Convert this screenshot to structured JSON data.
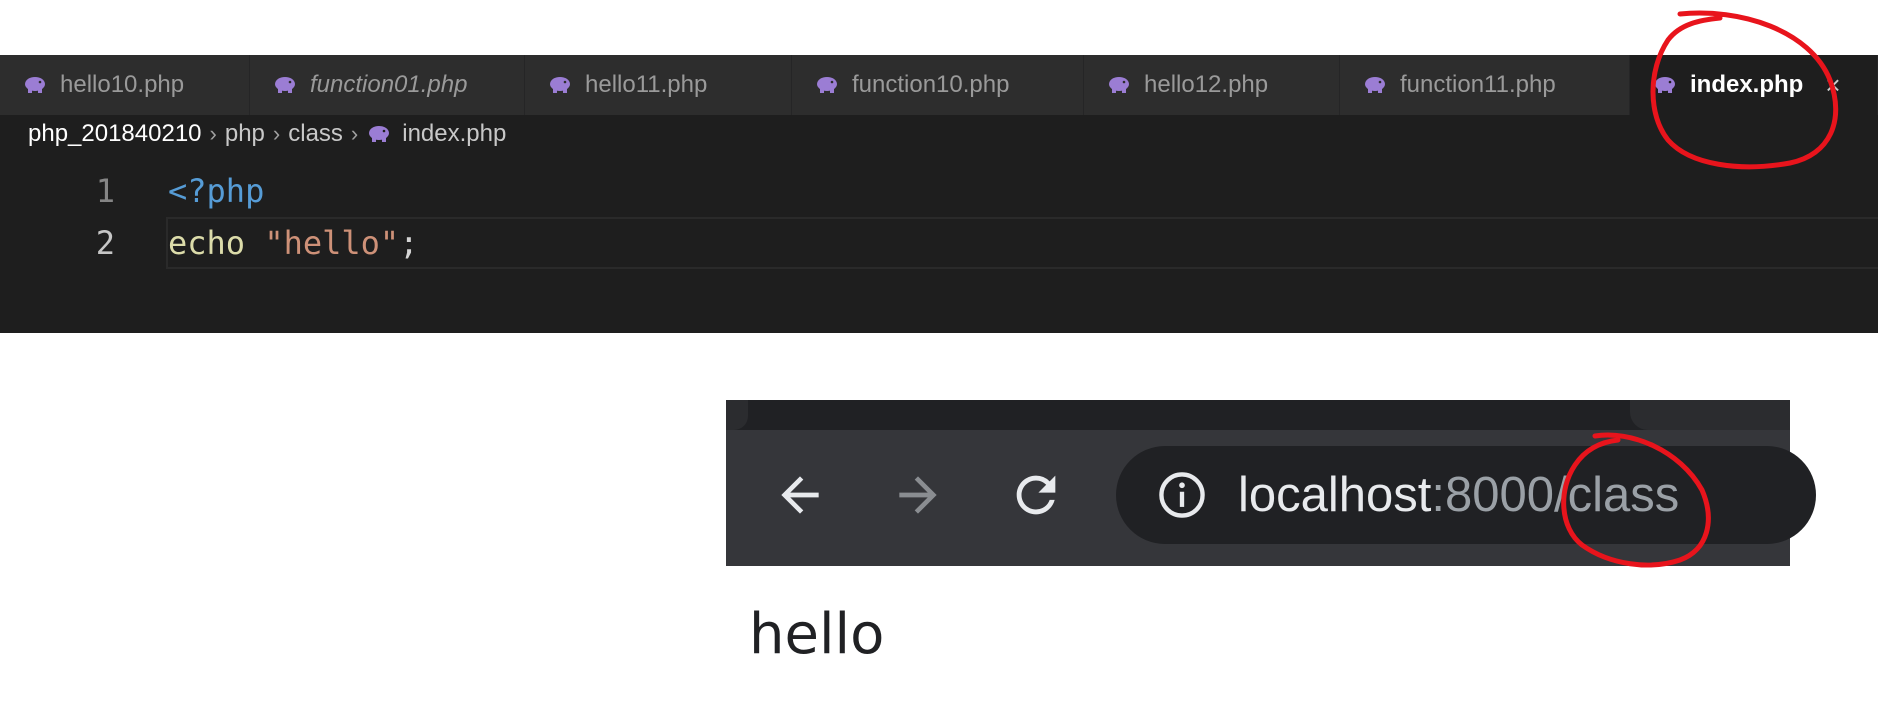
{
  "editor": {
    "tabs": [
      {
        "label": "hello10.php",
        "icon": "php-elephant-icon",
        "italic": false,
        "active": false
      },
      {
        "label": "function01.php",
        "icon": "php-elephant-icon",
        "italic": true,
        "active": false
      },
      {
        "label": "hello11.php",
        "icon": "php-elephant-icon",
        "italic": false,
        "active": false
      },
      {
        "label": "function10.php",
        "icon": "php-elephant-icon",
        "italic": false,
        "active": false
      },
      {
        "label": "hello12.php",
        "icon": "php-elephant-icon",
        "italic": false,
        "active": false
      },
      {
        "label": "function11.php",
        "icon": "php-elephant-icon",
        "italic": false,
        "active": false
      },
      {
        "label": "index.php",
        "icon": "php-elephant-icon",
        "italic": false,
        "active": true,
        "close": "×"
      }
    ],
    "breadcrumb": {
      "items": [
        "php_201840210",
        "php",
        "class",
        "index.php"
      ],
      "separator": "›"
    },
    "code_lines": [
      {
        "number": "1",
        "tokens": {
          "tag": "<?php"
        }
      },
      {
        "number": "2",
        "tokens": {
          "keyword": "echo",
          "string": "\"hello\"",
          "punct": ";"
        }
      }
    ]
  },
  "browser": {
    "back_icon": "arrow-left-icon",
    "forward_icon": "arrow-right-icon",
    "reload_icon": "reload-icon",
    "info_icon": "info-icon",
    "url_host": "localhost",
    "url_rest": ":8000/class",
    "page_text": "hello"
  },
  "colors": {
    "annotation": "#e8141c",
    "php_icon": "#9b7dd4",
    "editor_bg": "#1e1e1e",
    "browser_toolbar": "#35363a"
  }
}
